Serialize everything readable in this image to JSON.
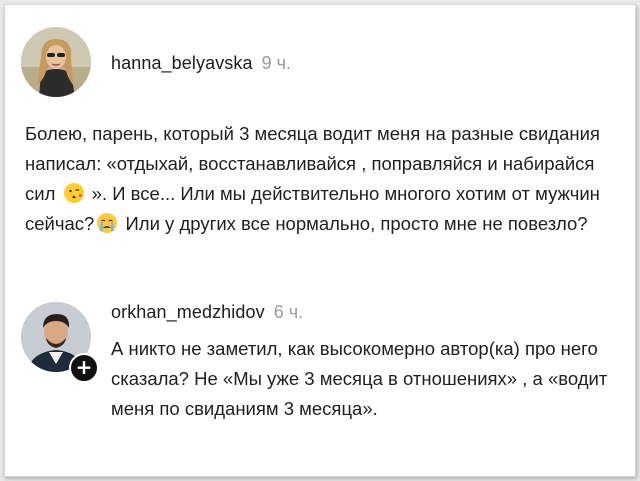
{
  "comments": [
    {
      "username": "hanna_belyavska",
      "time": "9 ч.",
      "text_a": "Болею, парень, который 3 месяца водит меня на разные свидания написал: «отдыхай, восстанавливайся , поправляйся и набирайся сил",
      "emoji_a": "kissing-face-emoji",
      "text_b": "». И все... Или мы действительно многого хотим от мужчин сейчас?",
      "emoji_b": "crying-face-emoji",
      "text_c": " Или у других все нормально, просто мне не повезло?"
    },
    {
      "username": "orkhan_medzhidov",
      "time": "6 ч.",
      "badge": "+",
      "text": "А никто не заметил, как высокомерно автор(ка) про него сказала? Не «Мы уже 3 месяца в отношениях» , а «водит меня по свиданиям 3 месяца»."
    }
  ],
  "colors": {
    "text": "#1f1f1f",
    "muted": "#9b9b9b",
    "background": "#ffffff"
  }
}
